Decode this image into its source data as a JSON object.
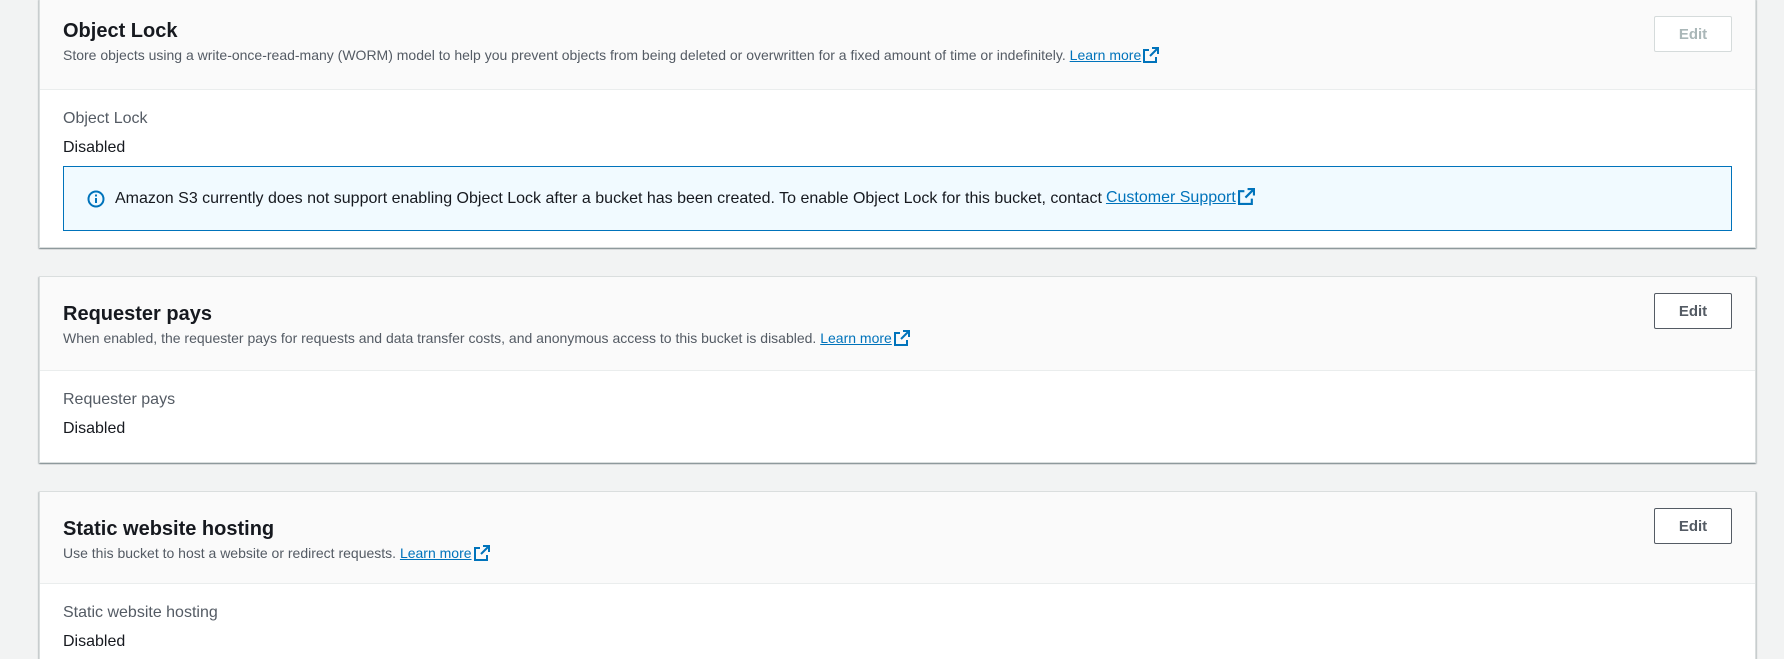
{
  "object_lock": {
    "title": "Object Lock",
    "description": "Store objects using a write-once-read-many (WORM) model to help you prevent objects from being deleted or overwritten for a fixed amount of time or indefinitely.",
    "learn_more": "Learn more",
    "edit_label": "Edit",
    "edit_disabled": true,
    "field_label": "Object Lock",
    "field_value": "Disabled",
    "alert_text": "Amazon S3 currently does not support enabling Object Lock after a bucket has been created. To enable Object Lock for this bucket, contact",
    "alert_link": "Customer Support"
  },
  "requester_pays": {
    "title": "Requester pays",
    "description": "When enabled, the requester pays for requests and data transfer costs, and anonymous access to this bucket is disabled.",
    "learn_more": "Learn more",
    "edit_label": "Edit",
    "field_label": "Requester pays",
    "field_value": "Disabled"
  },
  "static_website_hosting": {
    "title": "Static website hosting",
    "description": "Use this bucket to host a website or redirect requests.",
    "learn_more": "Learn more",
    "edit_label": "Edit",
    "field_label": "Static website hosting",
    "field_value": "Disabled"
  },
  "colors": {
    "link": "#0073bb",
    "info_border": "#0073bb",
    "info_bg": "#f1faff",
    "page_bg": "#f2f3f3"
  },
  "icons": {
    "external_link": "external-link-icon",
    "info": "info-icon"
  }
}
